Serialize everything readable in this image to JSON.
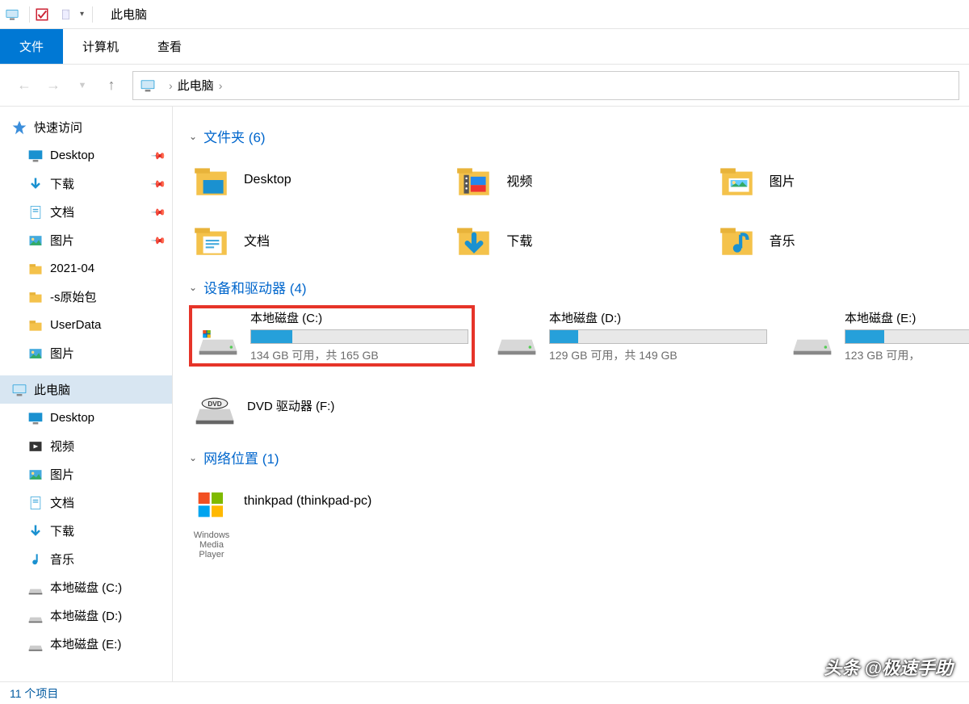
{
  "titlebar": {
    "title": "此电脑"
  },
  "ribbon": {
    "tabs": [
      "文件",
      "计算机",
      "查看"
    ],
    "activeIndex": 0
  },
  "breadcrumb": {
    "root": "此电脑"
  },
  "sidebar": {
    "quick": {
      "label": "快速访问",
      "items": [
        {
          "label": "Desktop",
          "pinned": true,
          "icon": "desktop"
        },
        {
          "label": "下载",
          "pinned": true,
          "icon": "downloads"
        },
        {
          "label": "文档",
          "pinned": true,
          "icon": "documents"
        },
        {
          "label": "图片",
          "pinned": true,
          "icon": "pictures"
        },
        {
          "label": "2021-04",
          "pinned": false,
          "icon": "folder"
        },
        {
          "label": "-s原始包",
          "pinned": false,
          "icon": "folder"
        },
        {
          "label": "UserData",
          "pinned": false,
          "icon": "folder"
        },
        {
          "label": "图片",
          "pinned": false,
          "icon": "pictures"
        }
      ]
    },
    "thispc": {
      "label": "此电脑",
      "items": [
        {
          "label": "Desktop",
          "icon": "desktop"
        },
        {
          "label": "视频",
          "icon": "videos"
        },
        {
          "label": "图片",
          "icon": "pictures"
        },
        {
          "label": "文档",
          "icon": "documents"
        },
        {
          "label": "下载",
          "icon": "downloads"
        },
        {
          "label": "音乐",
          "icon": "music"
        },
        {
          "label": "本地磁盘 (C:)",
          "icon": "drive"
        },
        {
          "label": "本地磁盘 (D:)",
          "icon": "drive"
        },
        {
          "label": "本地磁盘 (E:)",
          "icon": "drive"
        }
      ]
    }
  },
  "main": {
    "folders": {
      "heading": "文件夹 (6)",
      "items": [
        {
          "label": "Desktop",
          "icon": "desktop"
        },
        {
          "label": "视频",
          "icon": "videos"
        },
        {
          "label": "图片",
          "icon": "pictures"
        },
        {
          "label": "文档",
          "icon": "documents"
        },
        {
          "label": "下载",
          "icon": "downloads"
        },
        {
          "label": "音乐",
          "icon": "music"
        }
      ]
    },
    "drives": {
      "heading": "设备和驱动器 (4)",
      "items": [
        {
          "name": "本地磁盘 (C:)",
          "free": "134 GB 可用，共 165 GB",
          "pct": 19,
          "highlight": true,
          "os": true
        },
        {
          "name": "本地磁盘 (D:)",
          "free": "129 GB 可用，共 149 GB",
          "pct": 13,
          "highlight": false,
          "os": false
        },
        {
          "name": "本地磁盘 (E:)",
          "free": "123 GB 可用，",
          "pct": 18,
          "highlight": false,
          "os": false
        },
        {
          "name": "DVD 驱动器 (F:)",
          "dvd": true
        }
      ]
    },
    "network": {
      "heading": "网络位置 (1)",
      "items": [
        {
          "label": "thinkpad (thinkpad-pc)",
          "sub": "Windows Media Player"
        }
      ]
    }
  },
  "statusbar": {
    "text": "11 个项目"
  },
  "watermark": "头条 @极速手助"
}
